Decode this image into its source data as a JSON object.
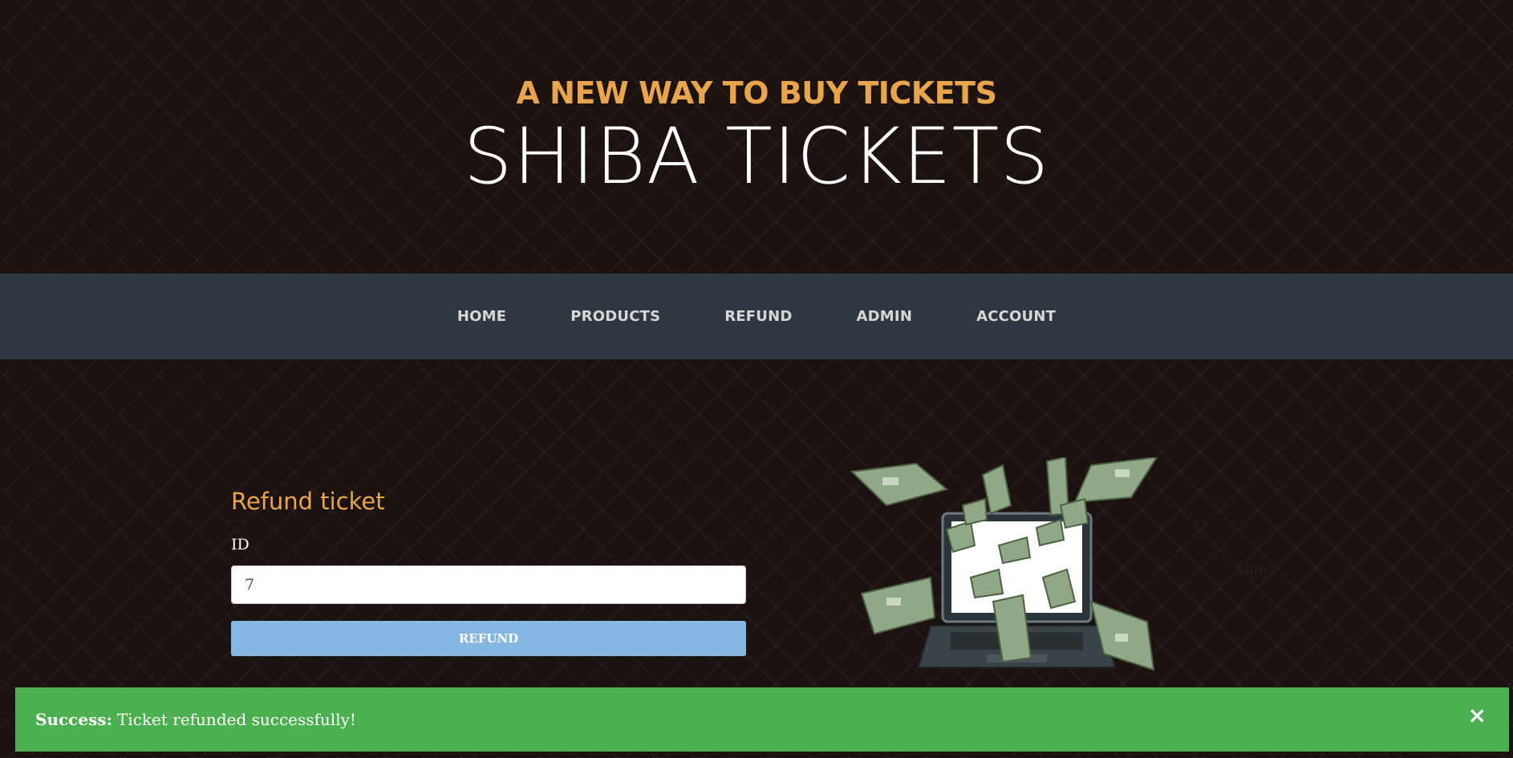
{
  "hero": {
    "tagline": "A NEW WAY TO BUY TICKETS",
    "brand": "SHIBA TICKETS"
  },
  "nav": {
    "items": [
      "HOME",
      "PRODUCTS",
      "REFUND",
      "ADMIN",
      "ACCOUNT"
    ]
  },
  "refund_form": {
    "title": "Refund ticket",
    "id_label": "ID",
    "id_value": "7",
    "submit_label": "REFUND"
  },
  "side": {
    "faint_label": "Label",
    "image_icon": "laptop-money-icon"
  },
  "alert": {
    "strong": "Success:",
    "message": "Ticket refunded successfully!",
    "close_glyph": "×"
  },
  "colors": {
    "accent": "#e8a54b",
    "nav_bg": "#303740",
    "button": "#84b7e1",
    "success": "#4caf50"
  }
}
